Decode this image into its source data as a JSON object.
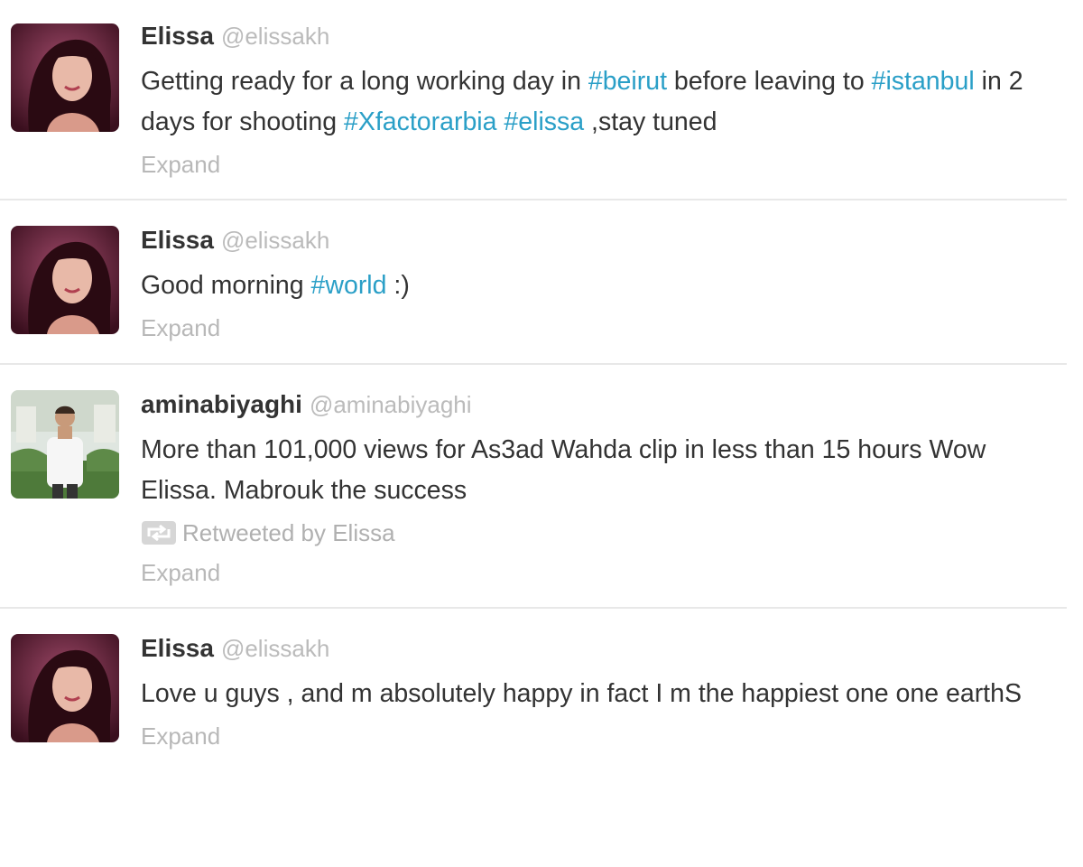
{
  "colors": {
    "hashtag": "#2a9fc7",
    "name": "#333333",
    "handle": "#bbbbbb",
    "muted": "#b8b8b8",
    "divider": "#e8e8e8"
  },
  "tweets": [
    {
      "name": "Elissa",
      "handle": "@elissakh",
      "avatar_icon": "elissa-avatar",
      "text": [
        {
          "t": "Getting ready for a long working day in ",
          "tag": false
        },
        {
          "t": "#beirut",
          "tag": true
        },
        {
          "t": " before leaving to ",
          "tag": false
        },
        {
          "t": "#istanbul",
          "tag": true
        },
        {
          "t": " in 2 days for shooting ",
          "tag": false
        },
        {
          "t": "#Xfactorarbia",
          "tag": true
        },
        {
          "t": " ",
          "tag": false
        },
        {
          "t": "#elissa",
          "tag": true
        },
        {
          "t": " ,stay tuned",
          "tag": false
        }
      ],
      "retweeted_by": "",
      "expand": "Expand"
    },
    {
      "name": "Elissa",
      "handle": "@elissakh",
      "avatar_icon": "elissa-avatar",
      "text": [
        {
          "t": "Good morning ",
          "tag": false
        },
        {
          "t": "#world",
          "tag": true
        },
        {
          "t": " :)",
          "tag": false
        }
      ],
      "retweeted_by": "",
      "expand": "Expand"
    },
    {
      "name": "aminabiyaghi",
      "handle": "@aminabiyaghi",
      "avatar_icon": "aminabiyaghi-avatar",
      "text": [
        {
          "t": "More than 101,000 views for As3ad Wahda clip in less than 15 hours Wow Elissa. Mabrouk the success",
          "tag": false
        }
      ],
      "retweeted_by": "Retweeted by Elissa",
      "retweet_icon": "retweet-icon",
      "expand": "Expand"
    },
    {
      "name": "Elissa",
      "handle": "@elissakh",
      "avatar_icon": "elissa-avatar",
      "text": [
        {
          "t": "Love u guys , and m absolutely happy in fact I m the happiest one one earthS",
          "tag": false
        }
      ],
      "retweeted_by": "",
      "expand": "Expand"
    }
  ]
}
